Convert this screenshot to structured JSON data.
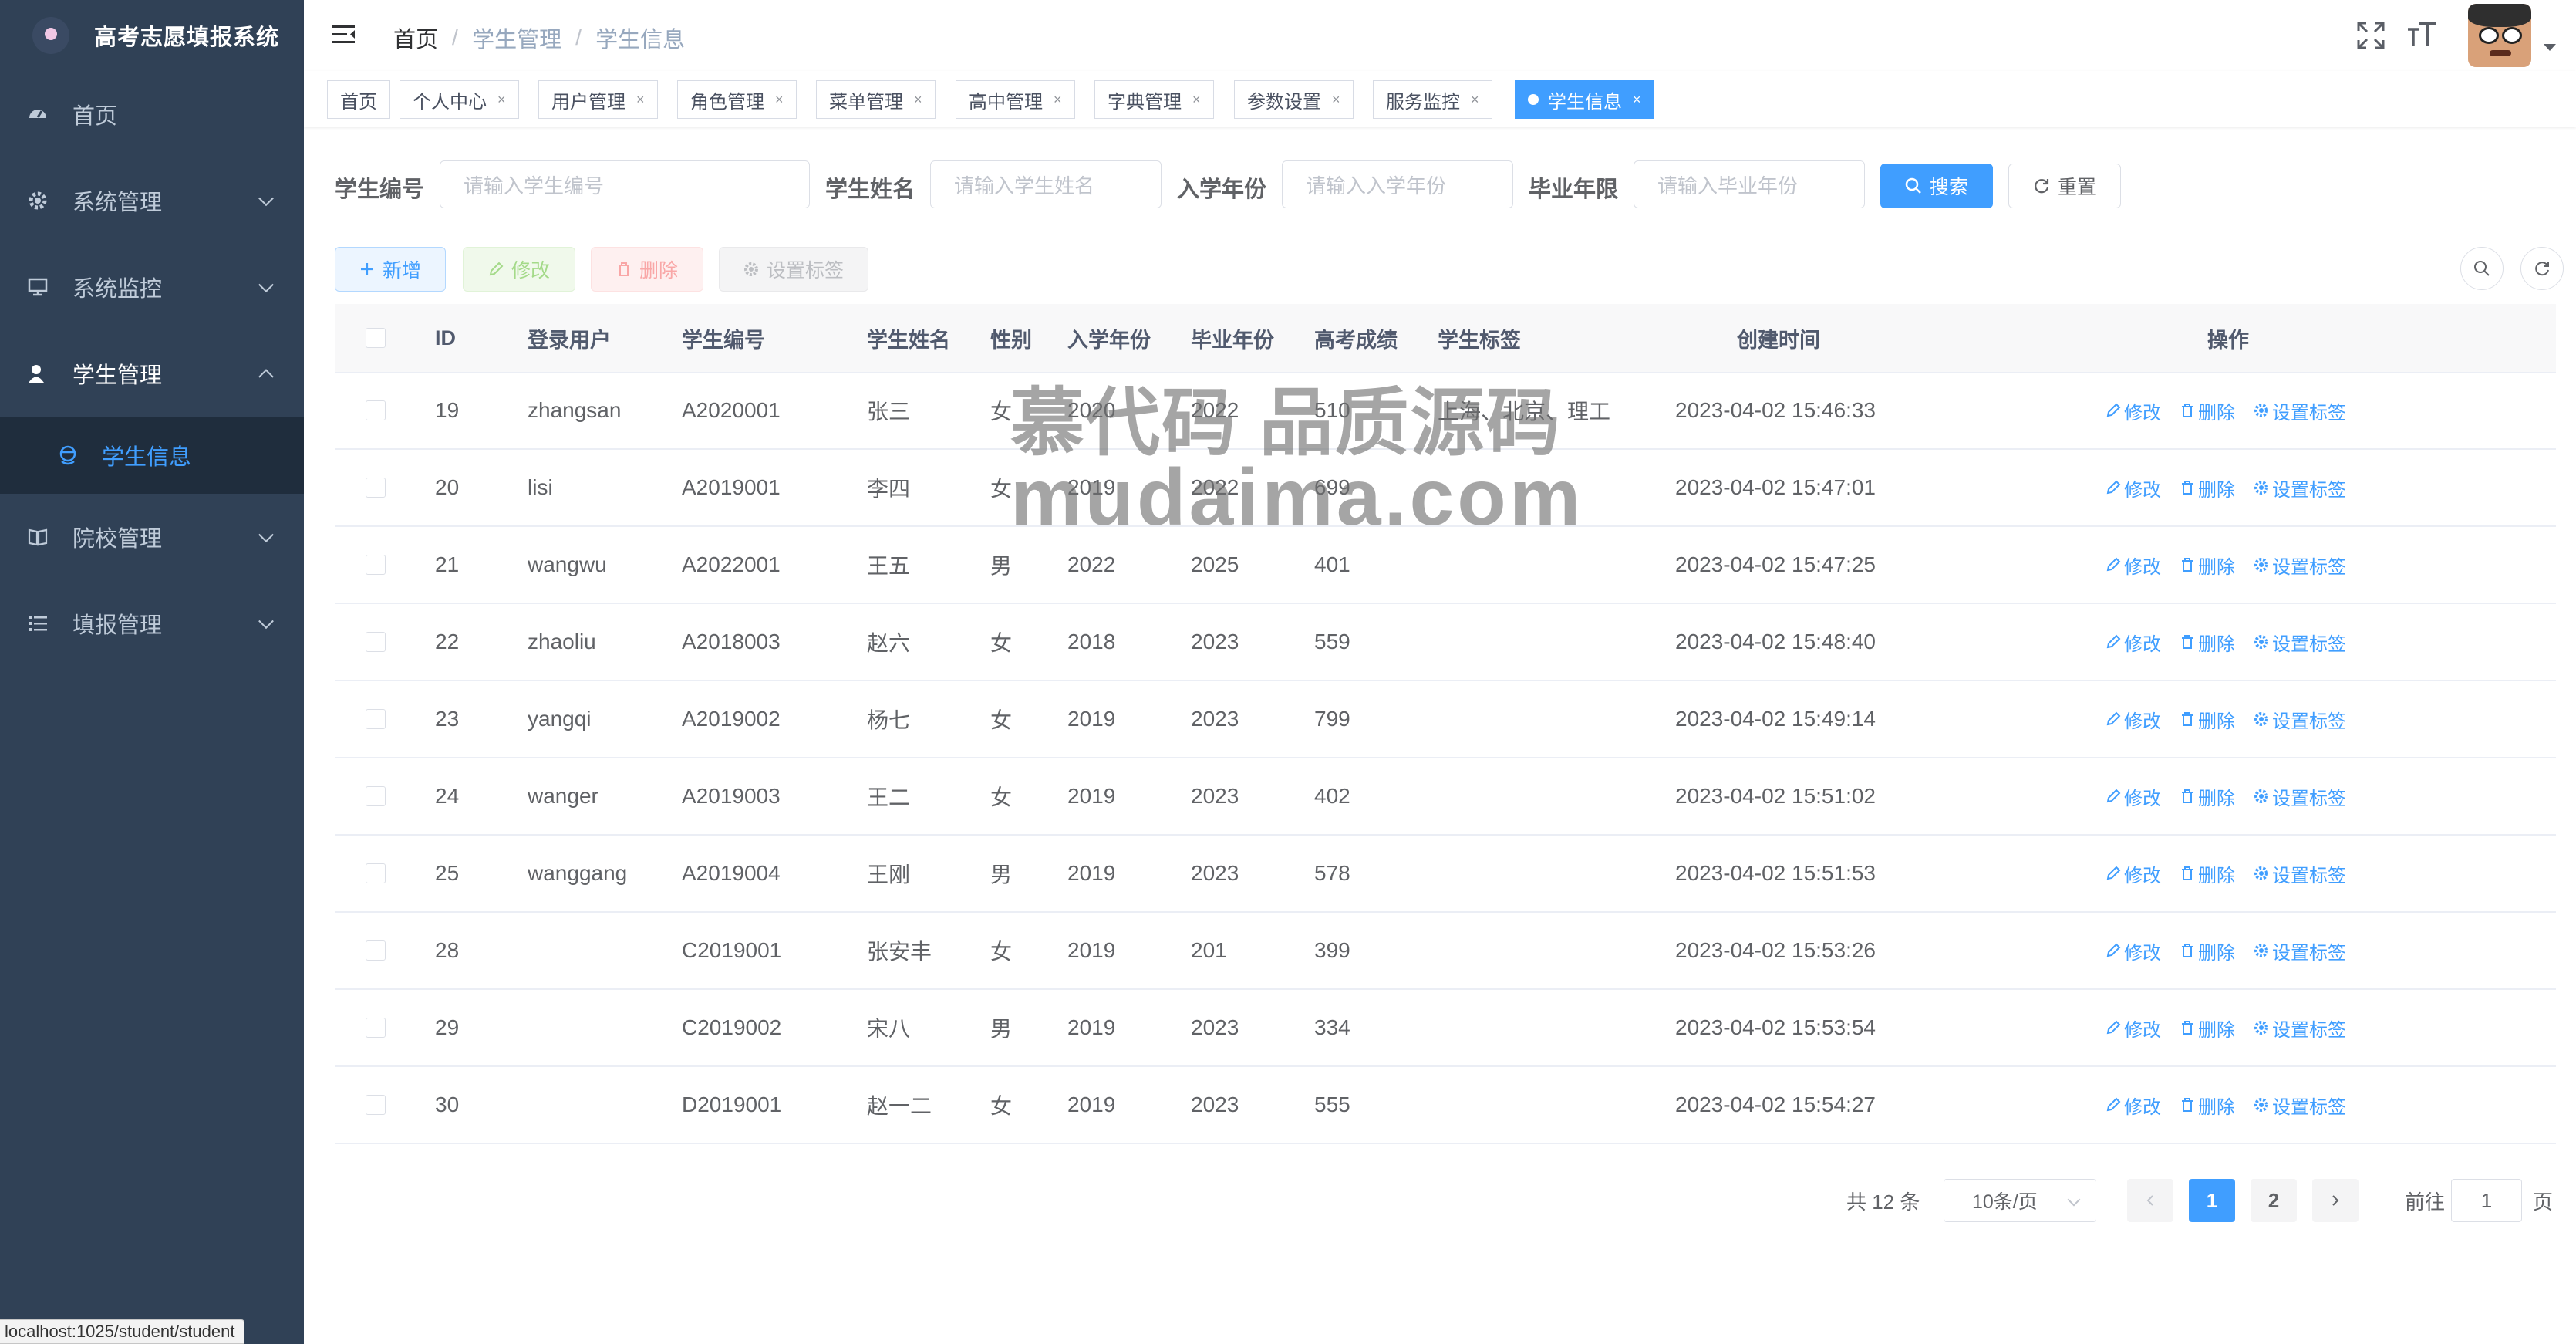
{
  "app": {
    "title": "高考志愿填报系统"
  },
  "sidebar": {
    "items": [
      {
        "label": "首页",
        "icon": "dashboard-icon"
      },
      {
        "label": "系统管理",
        "icon": "gear-icon"
      },
      {
        "label": "系统监控",
        "icon": "monitor-icon"
      },
      {
        "label": "学生管理",
        "icon": "user-icon",
        "open": true
      },
      {
        "label": "院校管理",
        "icon": "book-icon"
      },
      {
        "label": "填报管理",
        "icon": "list-icon"
      }
    ],
    "subitem": {
      "label": "学生信息",
      "icon": "student-icon"
    }
  },
  "breadcrumb": {
    "home": "首页",
    "parent": "学生管理",
    "current": "学生信息"
  },
  "tabs": [
    "首页",
    "个人中心",
    "用户管理",
    "角色管理",
    "菜单管理",
    "高中管理",
    "字典管理",
    "参数设置",
    "服务监控",
    "学生信息"
  ],
  "search": {
    "fields": [
      {
        "label": "学生编号",
        "placeholder": "请输入学生编号"
      },
      {
        "label": "学生姓名",
        "placeholder": "请输入学生姓名"
      },
      {
        "label": "入学年份",
        "placeholder": "请输入入学年份"
      },
      {
        "label": "毕业年限",
        "placeholder": "请输入毕业年份"
      }
    ],
    "search_label": "搜索",
    "reset_label": "重置"
  },
  "toolbar": {
    "add": "新增",
    "edit": "修改",
    "delete": "删除",
    "tag": "设置标签"
  },
  "table": {
    "headers": [
      "ID",
      "登录用户",
      "学生编号",
      "学生姓名",
      "性别",
      "入学年份",
      "毕业年份",
      "高考成绩",
      "学生标签",
      "创建时间",
      "操作"
    ],
    "ops": [
      "修改",
      "删除",
      "设置标签"
    ],
    "rows": [
      {
        "id": "19",
        "user": "zhangsan",
        "no": "A2020001",
        "name": "张三",
        "gender": "女",
        "enroll": "2020",
        "grad": "2022",
        "score": "510",
        "tags": "上海、北京、理工",
        "created": "2023-04-02 15:46:33"
      },
      {
        "id": "20",
        "user": "lisi",
        "no": "A2019001",
        "name": "李四",
        "gender": "女",
        "enroll": "2019",
        "grad": "2022",
        "score": "699",
        "tags": "",
        "created": "2023-04-02 15:47:01"
      },
      {
        "id": "21",
        "user": "wangwu",
        "no": "A2022001",
        "name": "王五",
        "gender": "男",
        "enroll": "2022",
        "grad": "2025",
        "score": "401",
        "tags": "",
        "created": "2023-04-02 15:47:25"
      },
      {
        "id": "22",
        "user": "zhaoliu",
        "no": "A2018003",
        "name": "赵六",
        "gender": "女",
        "enroll": "2018",
        "grad": "2023",
        "score": "559",
        "tags": "",
        "created": "2023-04-02 15:48:40"
      },
      {
        "id": "23",
        "user": "yangqi",
        "no": "A2019002",
        "name": "杨七",
        "gender": "女",
        "enroll": "2019",
        "grad": "2023",
        "score": "799",
        "tags": "",
        "created": "2023-04-02 15:49:14"
      },
      {
        "id": "24",
        "user": "wanger",
        "no": "A2019003",
        "name": "王二",
        "gender": "女",
        "enroll": "2019",
        "grad": "2023",
        "score": "402",
        "tags": "",
        "created": "2023-04-02 15:51:02"
      },
      {
        "id": "25",
        "user": "wanggang",
        "no": "A2019004",
        "name": "王刚",
        "gender": "男",
        "enroll": "2019",
        "grad": "2023",
        "score": "578",
        "tags": "",
        "created": "2023-04-02 15:51:53"
      },
      {
        "id": "28",
        "user": "",
        "no": "C2019001",
        "name": "张安丰",
        "gender": "女",
        "enroll": "2019",
        "grad": "201",
        "score": "399",
        "tags": "",
        "created": "2023-04-02 15:53:26"
      },
      {
        "id": "29",
        "user": "",
        "no": "C2019002",
        "name": "宋八",
        "gender": "男",
        "enroll": "2019",
        "grad": "2023",
        "score": "334",
        "tags": "",
        "created": "2023-04-02 15:53:54"
      },
      {
        "id": "30",
        "user": "",
        "no": "D2019001",
        "name": "赵一二",
        "gender": "女",
        "enroll": "2019",
        "grad": "2023",
        "score": "555",
        "tags": "",
        "created": "2023-04-02 15:54:27"
      }
    ]
  },
  "pagination": {
    "total": "共 12 条",
    "page_size": "10条/页",
    "pages": [
      "1",
      "2"
    ],
    "current": "1",
    "goto_prefix": "前往",
    "goto_value": "1",
    "goto_suffix": "页"
  },
  "watermark": {
    "line1": "慕代码 品质源码",
    "line2": "mudaima.com"
  },
  "status_url": "localhost:1025/student/student",
  "colors": {
    "sidebar": "#304156",
    "sidebar_active": "#1f2d3d",
    "primary": "#409eff"
  }
}
